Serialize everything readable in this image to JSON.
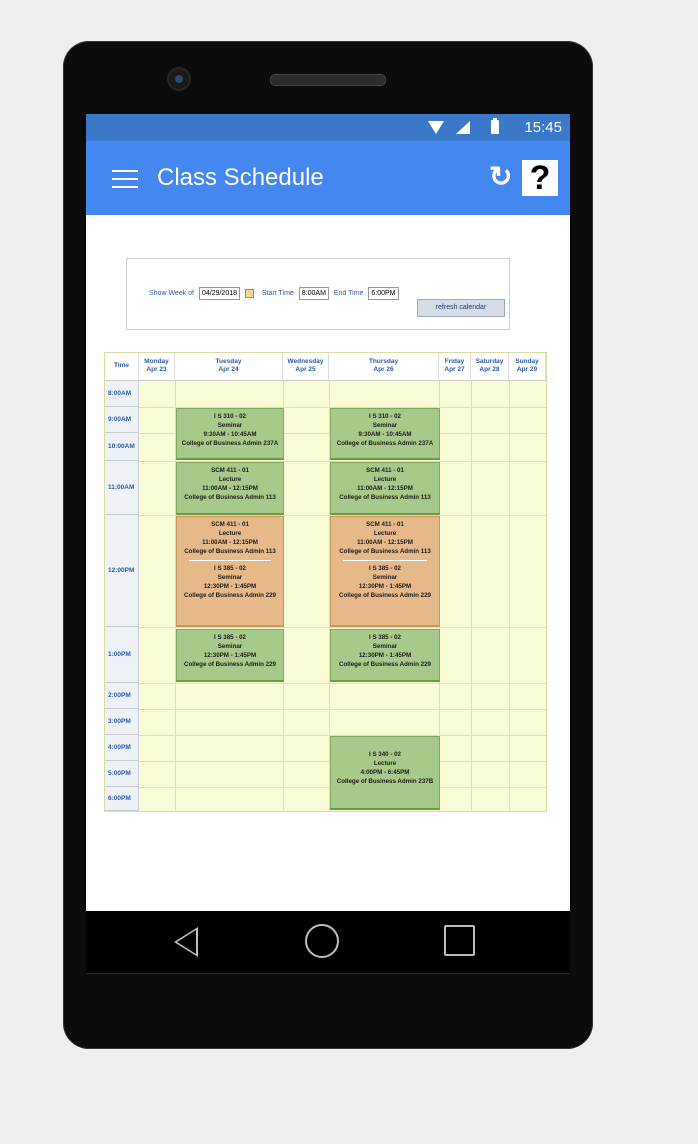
{
  "status_bar": {
    "time": "15:45"
  },
  "app_bar": {
    "title": "Class Schedule",
    "refresh_icon": "↻",
    "help_icon": "?"
  },
  "controls": {
    "show_week_label": "Show Week of",
    "show_week_value": "04/29/2018",
    "start_time_label": "Start Time",
    "start_time_value": "8:00AM",
    "end_time_label": "End Time",
    "end_time_value": "6:00PM",
    "refresh_button": "refresh calendar"
  },
  "calendar": {
    "time_header": "Time",
    "days": [
      {
        "name": "Monday",
        "date": "Apr 23"
      },
      {
        "name": "Tuesday",
        "date": "Apr 24"
      },
      {
        "name": "Wednesday",
        "date": "Apr 25"
      },
      {
        "name": "Thursday",
        "date": "Apr 26"
      },
      {
        "name": "Friday",
        "date": "Apr 27"
      },
      {
        "name": "Saturday",
        "date": "Apr 28"
      },
      {
        "name": "Sunday",
        "date": "Apr 29"
      }
    ],
    "times": [
      "8:00AM",
      "9:00AM",
      "10:00AM",
      "11:00AM",
      "12:00PM",
      "1:00PM",
      "2:00PM",
      "3:00PM",
      "4:00PM",
      "5:00PM",
      "6:00PM"
    ],
    "events": {
      "tue_is310": [
        "I S 310 - 02",
        "Seminar",
        "9:30AM - 10:45AM",
        "College of Business Admin 237A"
      ],
      "thu_is310": [
        "I S 310 - 02",
        "Seminar",
        "9:30AM - 10:45AM",
        "College of Business Admin 237A"
      ],
      "tue_scm411": [
        "SCM 411 - 01",
        "Lecture",
        "11:00AM - 12:15PM",
        "College of Business Admin 113"
      ],
      "thu_scm411": [
        "SCM 411 - 01",
        "Lecture",
        "11:00AM - 12:15PM",
        "College of Business Admin 113"
      ],
      "tue_overlap": {
        "a": [
          "SCM 411 - 01",
          "Lecture",
          "11:00AM - 12:15PM",
          "College of Business Admin 113"
        ],
        "b": [
          "I S 385 - 02",
          "Seminar",
          "12:30PM - 1:45PM",
          "College of Business Admin 229"
        ]
      },
      "thu_overlap": {
        "a": [
          "SCM 411 - 01",
          "Lecture",
          "11:00AM - 12:15PM",
          "College of Business Admin 113"
        ],
        "b": [
          "I S 385 - 02",
          "Seminar",
          "12:30PM - 1:45PM",
          "College of Business Admin 229"
        ]
      },
      "tue_is385": [
        "I S 385 - 02",
        "Seminar",
        "12:30PM - 1:45PM",
        "College of Business Admin 229"
      ],
      "thu_is385": [
        "I S 385 - 02",
        "Seminar",
        "12:30PM - 1:45PM",
        "College of Business Admin 229"
      ],
      "thu_is340": [
        "I S 340 - 02",
        "Lecture",
        "4:00PM - 6:45PM",
        "College of Business Admin 237B"
      ]
    }
  },
  "colors": {
    "accent": "#4387ef",
    "event_green": "#a7c98a",
    "event_orange": "#e6b98a",
    "calendar_bg": "#fafcd6"
  }
}
